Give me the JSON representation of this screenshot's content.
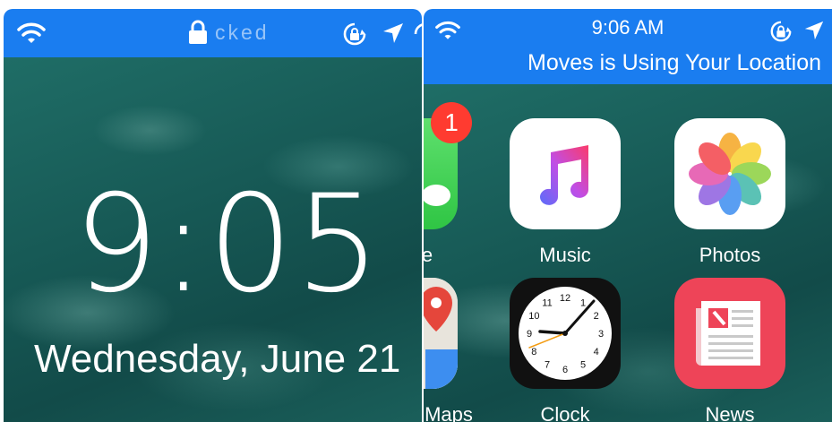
{
  "lock_screen": {
    "status_locked_text": "cked",
    "time": "9:05",
    "date": "Wednesday, June 21"
  },
  "home_screen": {
    "status_time": "9:06 AM",
    "location_banner": "Moves is Using Your Location",
    "apps": [
      {
        "label": "e",
        "badge": "1"
      },
      {
        "label": "Music"
      },
      {
        "label": "Photos"
      },
      {
        "label": "Maps"
      },
      {
        "label": "Clock"
      },
      {
        "label": "News"
      }
    ],
    "clock_numbers": [
      "12",
      "1",
      "2",
      "3",
      "4",
      "5",
      "6",
      "7",
      "8",
      "9",
      "10",
      "11"
    ]
  },
  "colors": {
    "status_bar": "#1a7df0",
    "badge": "#ff3b30",
    "news": "#ee4458"
  }
}
